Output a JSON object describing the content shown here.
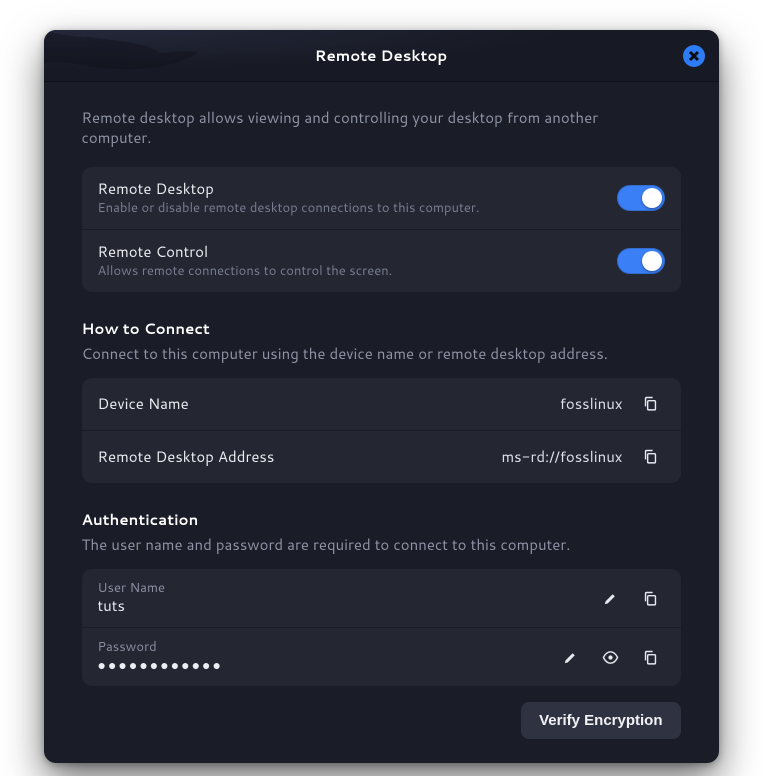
{
  "header": {
    "title": "Remote Desktop"
  },
  "intro": "Remote desktop allows viewing and controlling your desktop from another computer.",
  "toggles": {
    "remote_desktop": {
      "title": "Remote Desktop",
      "sub": "Enable or disable remote desktop connections to this computer.",
      "on": true
    },
    "remote_control": {
      "title": "Remote Control",
      "sub": "Allows remote connections to control the screen.",
      "on": true
    }
  },
  "connect": {
    "heading": "How to Connect",
    "sub": "Connect to this computer using the device name or remote desktop address.",
    "device_name_label": "Device Name",
    "device_name_value": "fosslinux",
    "rd_address_label": "Remote Desktop Address",
    "rd_address_value": "ms-rd://fosslinux"
  },
  "auth": {
    "heading": "Authentication",
    "sub": "The user name and password are required to connect to this computer.",
    "username_label": "User Name",
    "username_value": "tuts",
    "password_label": "Password",
    "password_mask": "●●●●●●●●●●●●"
  },
  "actions": {
    "verify_encryption": "Verify Encryption"
  },
  "colors": {
    "accent": "#3a7ff5",
    "bg": "#1a1d27",
    "panel": "#242632"
  }
}
